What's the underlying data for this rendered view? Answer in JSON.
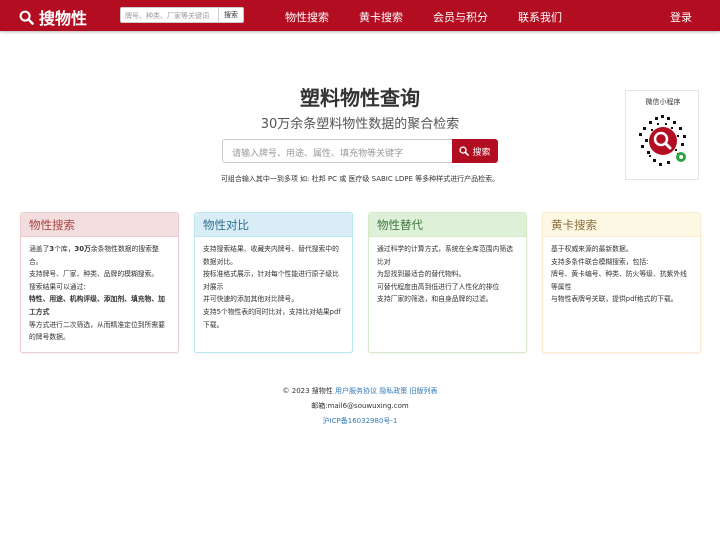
{
  "header": {
    "brand": "搜物性",
    "search_placeholder": "牌号、种类、厂家等关键词",
    "search_button": "搜索",
    "nav": [
      "物性搜索",
      "黄卡搜索",
      "会员与积分",
      "联系我们"
    ],
    "login": "登录",
    "accent_color": "#b30d22"
  },
  "hero": {
    "title": "塑料物性查询",
    "subtitle": "30万余条塑料物性数据的聚合检索",
    "search_placeholder": "请输入牌号、用途、属性、填充物等关键字",
    "search_button": "搜索",
    "hint": "可组合输入其中一到多项 如: 杜邦 PC 或 医疗级 SABIC LDPE 等多种样式进行产品检索。"
  },
  "qr": {
    "label": "微信小程序"
  },
  "panels": [
    {
      "title": "物性搜索",
      "lines": [
        {
          "pre": "涵盖了",
          "bold": "3",
          "post": "个库，"
        },
        {
          "pre": "",
          "bold": "30万",
          "post": "余条物性数据的搜索整合。"
        },
        {
          "pre": "支持牌号、厂家、种类、品牌的模糊搜索。",
          "bold": "",
          "post": ""
        },
        {
          "pre": "搜索结果可以通过:",
          "bold": "",
          "post": ""
        },
        {
          "pre": "",
          "bold": "特性、用途、机构评级、添加剂、填充物、加工方式",
          "post": ""
        },
        {
          "pre": "等方式进行二次筛选，从而精准定位到所需要的牌号数据。",
          "bold": "",
          "post": ""
        }
      ]
    },
    {
      "title": "物性对比",
      "lines": [
        "支持搜索结果、收藏夹内牌号、替代搜索中的数据对比。",
        "按标准格式展示，针对每个性能进行原子级比对展示",
        "并可快速的添加其他对比牌号。",
        "支持5个物性表的同时比对，支持比对结果pdf下载。"
      ]
    },
    {
      "title": "物性替代",
      "lines": [
        "通过科学的计算方式，系统在全库范围内筛选比对",
        "为您找到最适合的替代物料。",
        "可替代程度由高到低进行了人性化的排位",
        "支持厂家的筛选，和自身品牌的过滤。"
      ]
    },
    {
      "title": "黄卡搜索",
      "lines": [
        "基于权威来源的最新数据。",
        "支持多条件联合模糊搜索，包括:",
        "牌号、黄卡编号、种类、防火等级、抗紫外线等属性",
        "与物性表牌号关联，提供pdf格式的下载。"
      ]
    }
  ],
  "footer": {
    "copyright": "© 2023 搜物性",
    "links": [
      "用户服务协议",
      "隐私政策",
      "旧版列表"
    ],
    "email": "邮箱:mail6@souwuxing.com",
    "icp": "沪ICP备16032980号-1"
  }
}
